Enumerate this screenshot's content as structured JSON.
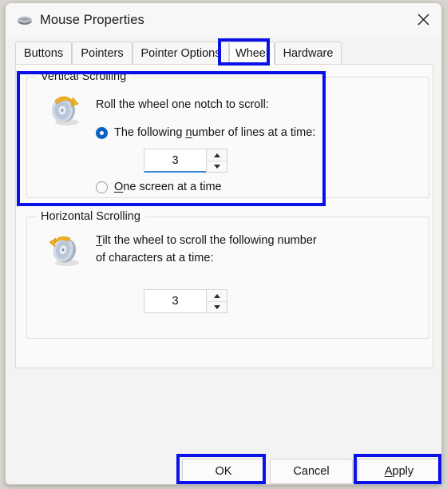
{
  "window": {
    "title": "Mouse Properties",
    "icon": "mouse-icon",
    "close_icon": "close-icon"
  },
  "tabs": [
    {
      "label": "Buttons",
      "selected": false
    },
    {
      "label": "Pointers",
      "selected": false
    },
    {
      "label": "Pointer Options",
      "selected": false
    },
    {
      "label": "Wheel",
      "selected": true
    },
    {
      "label": "Hardware",
      "selected": false
    }
  ],
  "vertical_scrolling": {
    "legend": "Vertical Scrolling",
    "icon": "scroll-wheel-vertical-icon",
    "prompt": "Roll the wheel one notch to scroll:",
    "option_lines": {
      "accel": "n",
      "before": "The following ",
      "after": "umber of lines at a time:",
      "selected": true
    },
    "lines_value": "3",
    "option_screen": {
      "accel": "O",
      "after": "ne screen at a time",
      "selected": false
    }
  },
  "horizontal_scrolling": {
    "legend": "Horizontal Scrolling",
    "icon": "scroll-wheel-horizontal-icon",
    "prompt_accel": "T",
    "prompt_line1_rest": "ilt the wheel to scroll the following number",
    "prompt_line2": "of characters at a time:",
    "chars_value": "3"
  },
  "footer": {
    "ok_label": "OK",
    "cancel_label": "Cancel",
    "apply_accel": "A",
    "apply_rest": "pply"
  },
  "annotations": {
    "highlight_color": "#0a10e8",
    "targets": [
      "wheel-tab",
      "vertical-scrolling-group",
      "ok-button",
      "apply-button"
    ]
  }
}
